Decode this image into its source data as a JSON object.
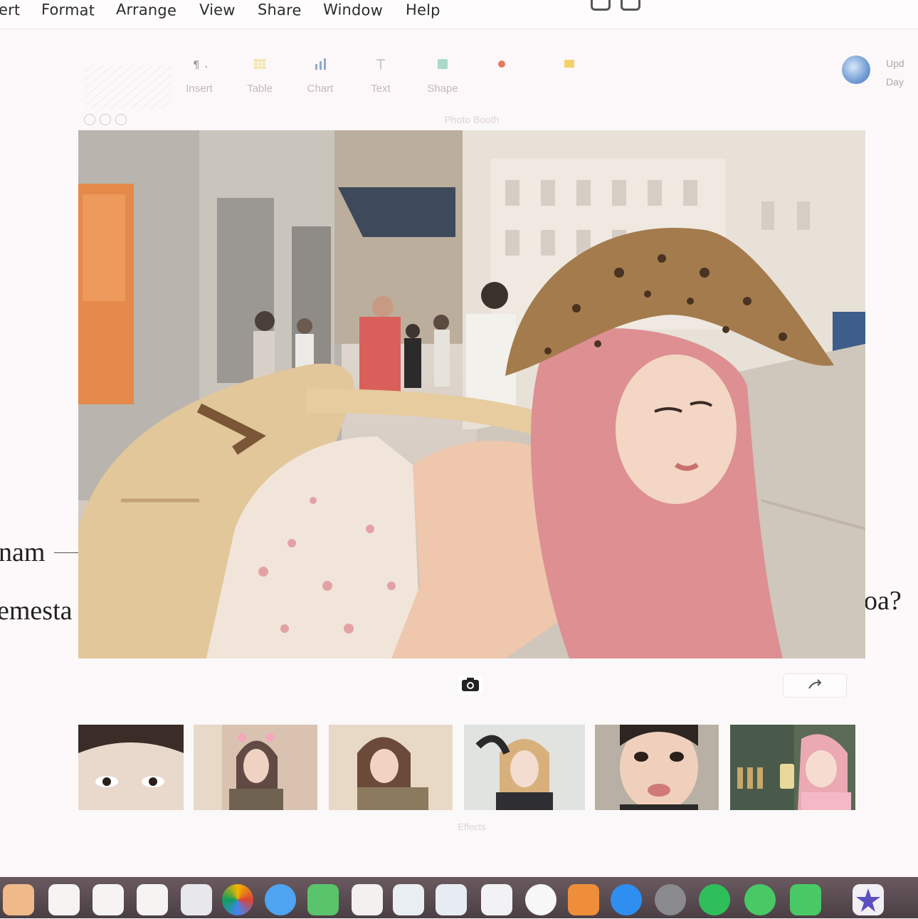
{
  "menubar": {
    "items": [
      "ert",
      "Format",
      "Arrange",
      "View",
      "Share",
      "Window",
      "Help"
    ]
  },
  "toolbar": {
    "tools": [
      {
        "label": "Insert",
        "icon": "paragraph-icon"
      },
      {
        "label": "Table",
        "icon": "table-icon"
      },
      {
        "label": "Chart",
        "icon": "chart-icon"
      },
      {
        "label": "Text",
        "icon": "text-icon"
      },
      {
        "label": "Shape",
        "icon": "shape-icon"
      }
    ],
    "account_text": [
      "Upd",
      "Day"
    ]
  },
  "document": {
    "fragments": [
      "nam",
      "emesta",
      "oa?"
    ]
  },
  "photo_window": {
    "title": "Photo Booth",
    "caption": "Effects"
  },
  "colors": {
    "background": "#fdf9fb",
    "hair_pink": "#dd8f92",
    "shop_orange": "#e58a4a",
    "dock": "#5a4c52"
  },
  "dock": {
    "icons": [
      "notes-icon",
      "calendar-icon",
      "reminders-icon",
      "pages-icon",
      "contacts-icon",
      "photos-icon",
      "messages-icon",
      "facetime-icon",
      "preview-icon",
      "numbers-icon",
      "keynote-icon",
      "textedit-icon",
      "music-icon",
      "books-icon",
      "app-store-icon",
      "settings-icon",
      "spotify-icon",
      "whatsapp-icon",
      "line-icon",
      "star-icon"
    ]
  }
}
